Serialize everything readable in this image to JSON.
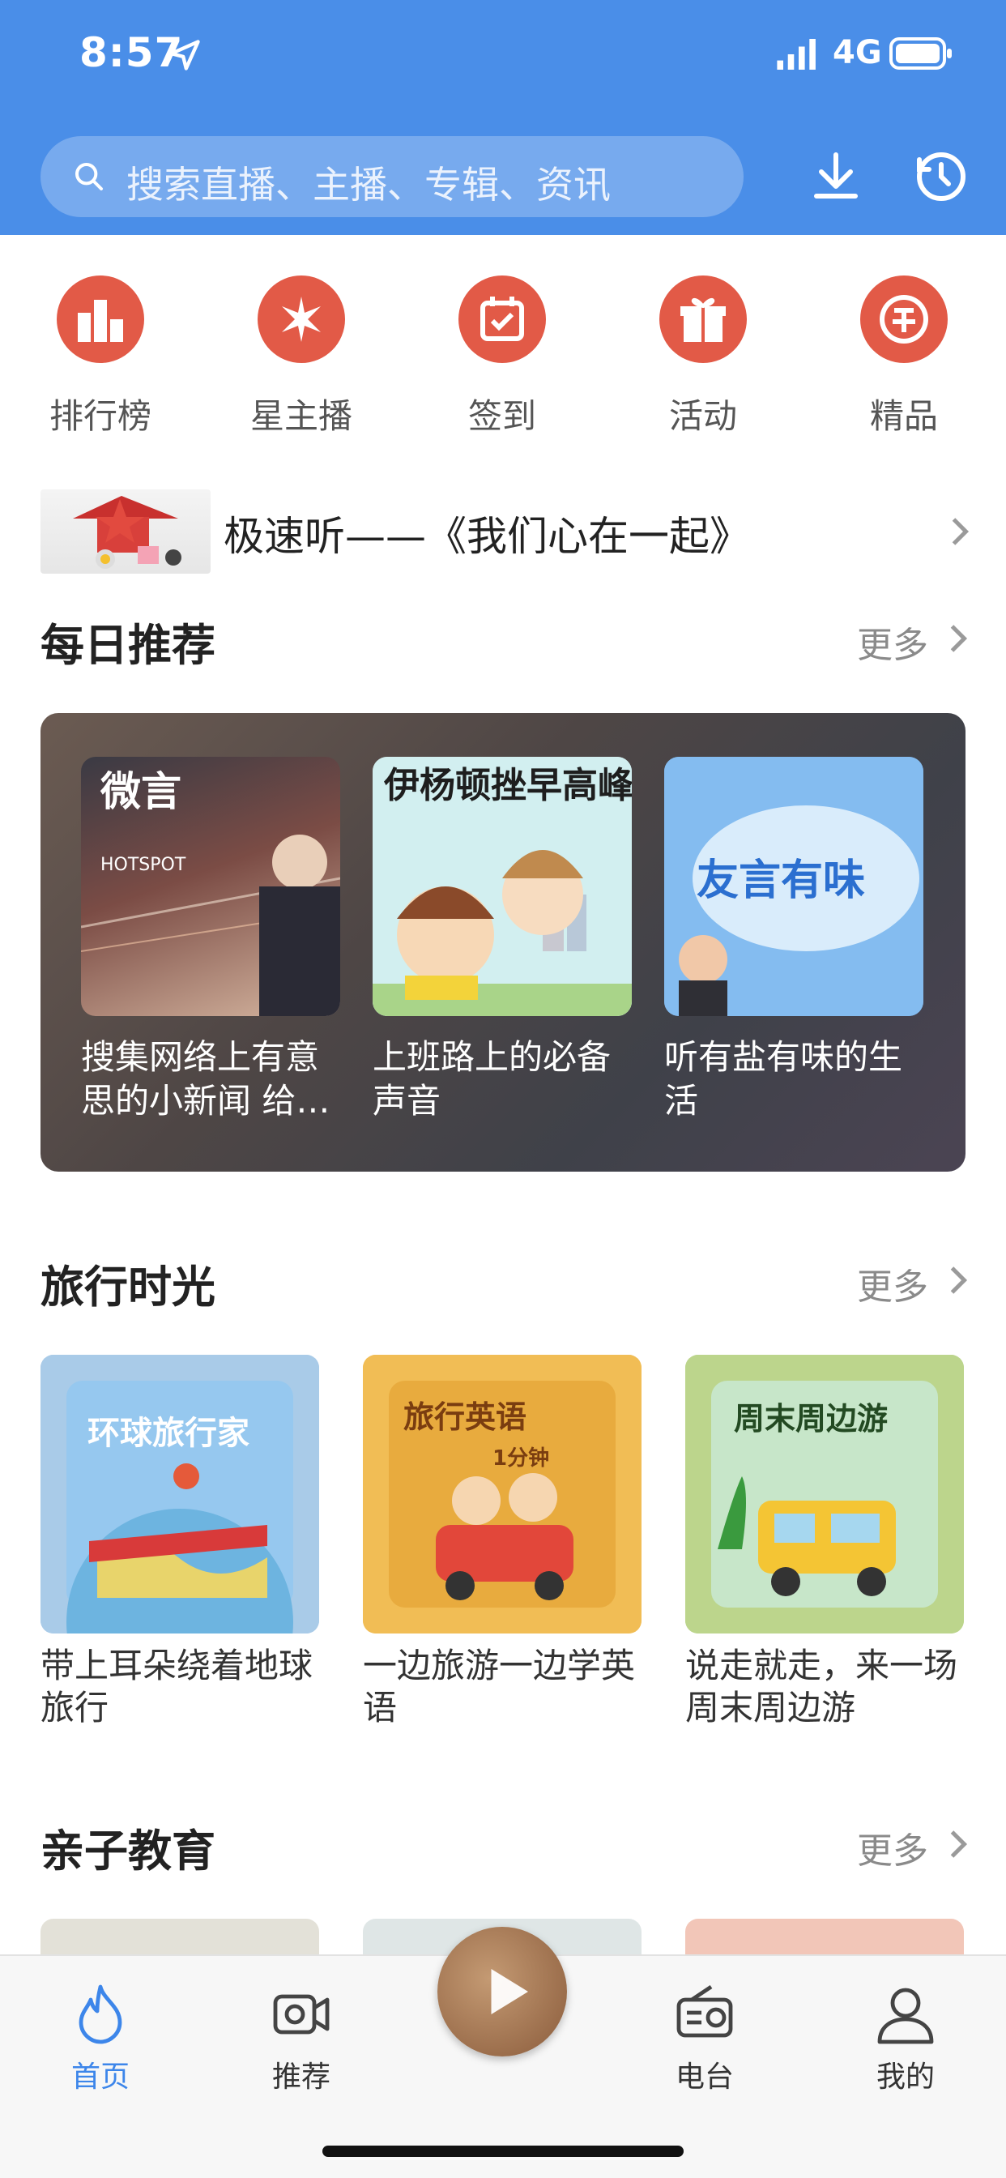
{
  "status_bar": {
    "time": "8:57",
    "network": "4G"
  },
  "search": {
    "placeholder": "搜索直播、主播、专辑、资讯"
  },
  "quick_links": [
    {
      "label": "排行榜",
      "icon": "ranking-podium-icon"
    },
    {
      "label": "星主播",
      "icon": "star-burst-icon"
    },
    {
      "label": "签到",
      "icon": "calendar-check-icon"
    },
    {
      "label": "活动",
      "icon": "gift-box-icon"
    },
    {
      "label": "精品",
      "icon": "premium-badge-icon"
    }
  ],
  "banner": {
    "text": "极速听——《我们心在一起》"
  },
  "daily": {
    "title": "每日推荐",
    "more": "更多",
    "items": [
      {
        "caption": "搜集网络上有意思的小新闻 给…",
        "cover_text": "微言",
        "cover_sub": "HOTSPOT"
      },
      {
        "caption": "上班路上的必备声音",
        "cover_text": "伊杨顿挫早高峰"
      },
      {
        "caption": "听有盐有味的生活",
        "cover_text": "友言有味"
      }
    ]
  },
  "travel": {
    "title": "旅行时光",
    "more": "更多",
    "items": [
      {
        "caption": "带上耳朵绕着地球旅行",
        "cover_text": "环球旅行家"
      },
      {
        "caption": "一边旅游一边学英语",
        "cover_text": "旅行英语",
        "cover_sub": "1分钟"
      },
      {
        "caption": "说走就走，来一场周末周边游",
        "cover_text": "周末周边游"
      }
    ]
  },
  "parenting": {
    "title": "亲子教育",
    "more": "更多"
  },
  "tabbar": {
    "items": [
      {
        "label": "首页",
        "active": true
      },
      {
        "label": "推荐"
      },
      {
        "label": "电台"
      },
      {
        "label": "我的"
      }
    ]
  },
  "colors": {
    "primary": "#4a8ee8",
    "accent_red": "#e25a47",
    "active_tab": "#3d86ea"
  }
}
